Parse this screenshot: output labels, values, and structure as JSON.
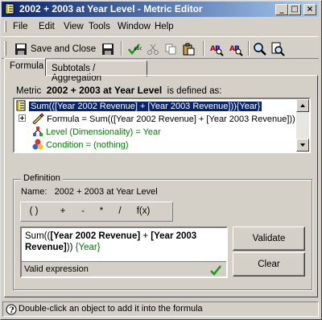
{
  "window": {
    "title": "2002 + 2003 at Year Level - Metric Editor",
    "buttons": {
      "minimize": "_",
      "maximize": "□",
      "close": "×"
    }
  },
  "menu": {
    "file": "File",
    "edit": "Edit",
    "view": "View",
    "tools": "Tools",
    "window": "Window",
    "help": "Help"
  },
  "toolbar": {
    "save_and_close": "Save and Close"
  },
  "tabs": {
    "formula": "Formula",
    "subtotals": "Subtotals / Aggregation"
  },
  "metric": {
    "prefix": "Metric",
    "name": "2002 + 2003 at Year Level",
    "suffix": "is defined as:"
  },
  "tree": {
    "root": "Sum(([Year 2002 Revenue] + [Year 2003 Revenue])){Year}",
    "formula": "Formula = Sum(([Year 2002 Revenue] + [Year 2003 Revenue]))",
    "level": "Level (Dimensionality) = Year",
    "condition": "Condition = (nothing)"
  },
  "definition": {
    "legend": "Definition",
    "name_label": "Name:",
    "name_value": "2002 + 2003 at Year Level",
    "operators": [
      "( )",
      "+",
      "-",
      "*",
      "/",
      "f(x)"
    ],
    "formula_parts": {
      "p1": "Sum((",
      "p2": "[Year 2002 Revenue]",
      "p3": " + ",
      "p4": "[Year 2003 Revenue]",
      "p5": ")) ",
      "p6": "{Year}"
    },
    "valid_text": "Valid expression",
    "validate_label": "Validate",
    "clear_label": "Clear"
  },
  "status": {
    "text": "Double-click an object to add it into the formula"
  },
  "colors": {
    "title_start": "#0a246a",
    "title_end": "#a6caf0",
    "selection": "#0a246a",
    "level_green": "#007f00",
    "check_green": "#1a9a1a"
  }
}
